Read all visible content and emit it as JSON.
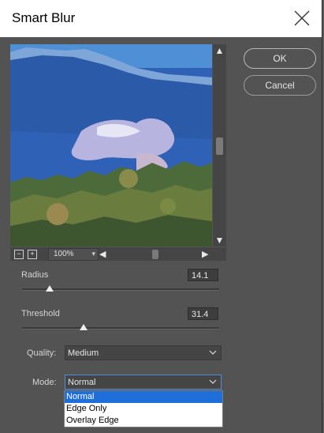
{
  "window": {
    "title": "Smart Blur"
  },
  "buttons": {
    "ok": "OK",
    "cancel": "Cancel"
  },
  "preview": {
    "zoom": "100%"
  },
  "parameters": {
    "radius": {
      "label": "Radius",
      "value": "14.1",
      "fraction": 0.14
    },
    "threshold": {
      "label": "Threshold",
      "value": "31.4",
      "fraction": 0.31
    }
  },
  "quality": {
    "label": "Quality:",
    "selected": "Medium"
  },
  "mode": {
    "label": "Mode:",
    "selected": "Normal",
    "options": [
      "Normal",
      "Edge Only",
      "Overlay Edge"
    ]
  },
  "icons": {
    "close": "close-icon",
    "zoom_out": "zoom-out-icon",
    "zoom_in": "zoom-in-icon",
    "chevron": "chevron-down-icon"
  }
}
